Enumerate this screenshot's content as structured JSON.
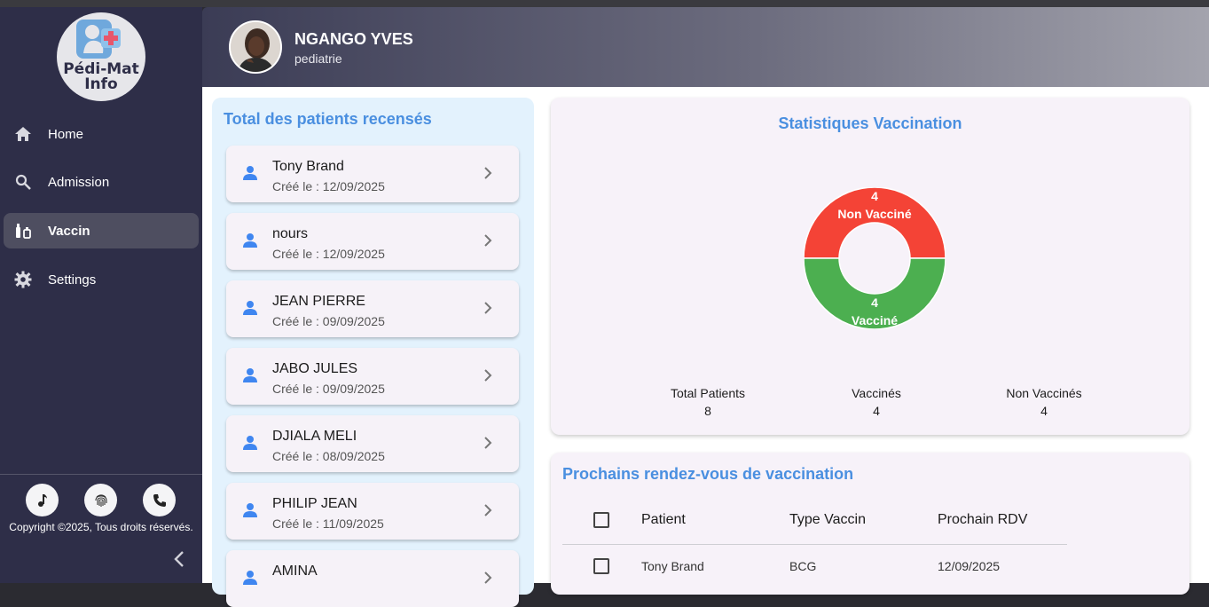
{
  "brand": {
    "logo_line1": "Pédi-Mat",
    "logo_line2": "Info"
  },
  "sidebar": {
    "items": [
      {
        "label": "Home",
        "icon": "home-icon"
      },
      {
        "label": "Admission",
        "icon": "search-icon"
      },
      {
        "label": "Vaccin",
        "icon": "vaccine-icon",
        "active": true
      },
      {
        "label": "Settings",
        "icon": "gear-icon"
      }
    ],
    "bottom_icons": [
      "music-icon",
      "fingerprint-icon",
      "phone-icon"
    ],
    "copyright": "Copyright ©2025, Tous droits réservés."
  },
  "header": {
    "name": "NGANGO YVES",
    "role": "pediatrie"
  },
  "patients": {
    "title": "Total des patients recensés",
    "items": [
      {
        "name": "Tony Brand",
        "date": "Créé le : 12/09/2025"
      },
      {
        "name": "nours",
        "date": "Créé le : 12/09/2025"
      },
      {
        "name": "JEAN PIERRE",
        "date": "Créé le : 09/09/2025"
      },
      {
        "name": "JABO JULES",
        "date": "Créé le : 09/09/2025"
      },
      {
        "name": "DJIALA MELI",
        "date": "Créé le : 08/09/2025"
      },
      {
        "name": "PHILIP JEAN",
        "date": "Créé le : 11/09/2025"
      },
      {
        "name": "AMINA",
        "date": ""
      }
    ]
  },
  "stats": {
    "title": "Statistiques Vaccination",
    "total_label": "Total Patients",
    "total_value": "8",
    "vaccinated_label": "Vaccinés",
    "vaccinated_value": "4",
    "non_vaccinated_label": "Non Vaccinés",
    "non_vaccinated_value": "4"
  },
  "chart_data": {
    "type": "pie",
    "categories": [
      "Non Vacciné",
      "Vacciné"
    ],
    "values": [
      4,
      4
    ],
    "colors": [
      "#f44336",
      "#4caf50"
    ]
  },
  "rdv": {
    "title": "Prochains rendez-vous de vaccination",
    "columns": [
      "Patient",
      "Type Vaccin",
      "Prochain RDV"
    ],
    "rows": [
      {
        "patient": "Tony Brand",
        "type": "BCG",
        "date": "12/09/2025"
      }
    ]
  }
}
